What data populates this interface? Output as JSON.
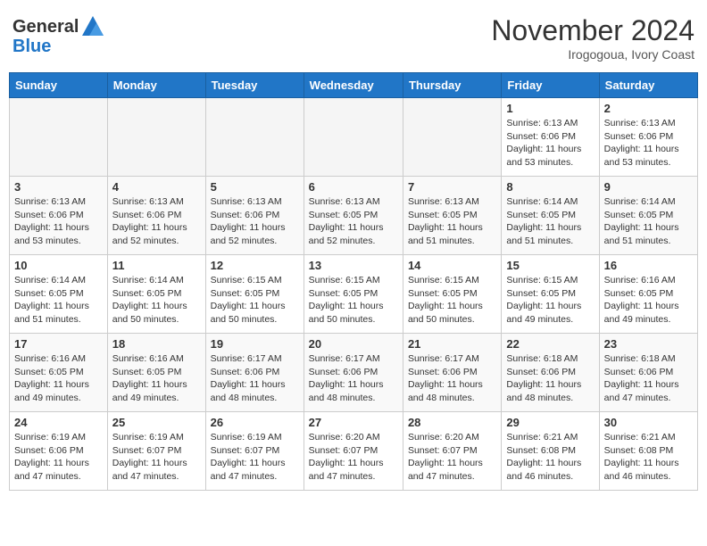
{
  "header": {
    "logo_line1": "General",
    "logo_line2": "Blue",
    "month_title": "November 2024",
    "location": "Irogogoua, Ivory Coast"
  },
  "weekdays": [
    "Sunday",
    "Monday",
    "Tuesday",
    "Wednesday",
    "Thursday",
    "Friday",
    "Saturday"
  ],
  "weeks": [
    [
      {
        "day": "",
        "info": ""
      },
      {
        "day": "",
        "info": ""
      },
      {
        "day": "",
        "info": ""
      },
      {
        "day": "",
        "info": ""
      },
      {
        "day": "",
        "info": ""
      },
      {
        "day": "1",
        "info": "Sunrise: 6:13 AM\nSunset: 6:06 PM\nDaylight: 11 hours\nand 53 minutes."
      },
      {
        "day": "2",
        "info": "Sunrise: 6:13 AM\nSunset: 6:06 PM\nDaylight: 11 hours\nand 53 minutes."
      }
    ],
    [
      {
        "day": "3",
        "info": "Sunrise: 6:13 AM\nSunset: 6:06 PM\nDaylight: 11 hours\nand 53 minutes."
      },
      {
        "day": "4",
        "info": "Sunrise: 6:13 AM\nSunset: 6:06 PM\nDaylight: 11 hours\nand 52 minutes."
      },
      {
        "day": "5",
        "info": "Sunrise: 6:13 AM\nSunset: 6:06 PM\nDaylight: 11 hours\nand 52 minutes."
      },
      {
        "day": "6",
        "info": "Sunrise: 6:13 AM\nSunset: 6:05 PM\nDaylight: 11 hours\nand 52 minutes."
      },
      {
        "day": "7",
        "info": "Sunrise: 6:13 AM\nSunset: 6:05 PM\nDaylight: 11 hours\nand 51 minutes."
      },
      {
        "day": "8",
        "info": "Sunrise: 6:14 AM\nSunset: 6:05 PM\nDaylight: 11 hours\nand 51 minutes."
      },
      {
        "day": "9",
        "info": "Sunrise: 6:14 AM\nSunset: 6:05 PM\nDaylight: 11 hours\nand 51 minutes."
      }
    ],
    [
      {
        "day": "10",
        "info": "Sunrise: 6:14 AM\nSunset: 6:05 PM\nDaylight: 11 hours\nand 51 minutes."
      },
      {
        "day": "11",
        "info": "Sunrise: 6:14 AM\nSunset: 6:05 PM\nDaylight: 11 hours\nand 50 minutes."
      },
      {
        "day": "12",
        "info": "Sunrise: 6:15 AM\nSunset: 6:05 PM\nDaylight: 11 hours\nand 50 minutes."
      },
      {
        "day": "13",
        "info": "Sunrise: 6:15 AM\nSunset: 6:05 PM\nDaylight: 11 hours\nand 50 minutes."
      },
      {
        "day": "14",
        "info": "Sunrise: 6:15 AM\nSunset: 6:05 PM\nDaylight: 11 hours\nand 50 minutes."
      },
      {
        "day": "15",
        "info": "Sunrise: 6:15 AM\nSunset: 6:05 PM\nDaylight: 11 hours\nand 49 minutes."
      },
      {
        "day": "16",
        "info": "Sunrise: 6:16 AM\nSunset: 6:05 PM\nDaylight: 11 hours\nand 49 minutes."
      }
    ],
    [
      {
        "day": "17",
        "info": "Sunrise: 6:16 AM\nSunset: 6:05 PM\nDaylight: 11 hours\nand 49 minutes."
      },
      {
        "day": "18",
        "info": "Sunrise: 6:16 AM\nSunset: 6:05 PM\nDaylight: 11 hours\nand 49 minutes."
      },
      {
        "day": "19",
        "info": "Sunrise: 6:17 AM\nSunset: 6:06 PM\nDaylight: 11 hours\nand 48 minutes."
      },
      {
        "day": "20",
        "info": "Sunrise: 6:17 AM\nSunset: 6:06 PM\nDaylight: 11 hours\nand 48 minutes."
      },
      {
        "day": "21",
        "info": "Sunrise: 6:17 AM\nSunset: 6:06 PM\nDaylight: 11 hours\nand 48 minutes."
      },
      {
        "day": "22",
        "info": "Sunrise: 6:18 AM\nSunset: 6:06 PM\nDaylight: 11 hours\nand 48 minutes."
      },
      {
        "day": "23",
        "info": "Sunrise: 6:18 AM\nSunset: 6:06 PM\nDaylight: 11 hours\nand 47 minutes."
      }
    ],
    [
      {
        "day": "24",
        "info": "Sunrise: 6:19 AM\nSunset: 6:06 PM\nDaylight: 11 hours\nand 47 minutes."
      },
      {
        "day": "25",
        "info": "Sunrise: 6:19 AM\nSunset: 6:07 PM\nDaylight: 11 hours\nand 47 minutes."
      },
      {
        "day": "26",
        "info": "Sunrise: 6:19 AM\nSunset: 6:07 PM\nDaylight: 11 hours\nand 47 minutes."
      },
      {
        "day": "27",
        "info": "Sunrise: 6:20 AM\nSunset: 6:07 PM\nDaylight: 11 hours\nand 47 minutes."
      },
      {
        "day": "28",
        "info": "Sunrise: 6:20 AM\nSunset: 6:07 PM\nDaylight: 11 hours\nand 47 minutes."
      },
      {
        "day": "29",
        "info": "Sunrise: 6:21 AM\nSunset: 6:08 PM\nDaylight: 11 hours\nand 46 minutes."
      },
      {
        "day": "30",
        "info": "Sunrise: 6:21 AM\nSunset: 6:08 PM\nDaylight: 11 hours\nand 46 minutes."
      }
    ]
  ]
}
